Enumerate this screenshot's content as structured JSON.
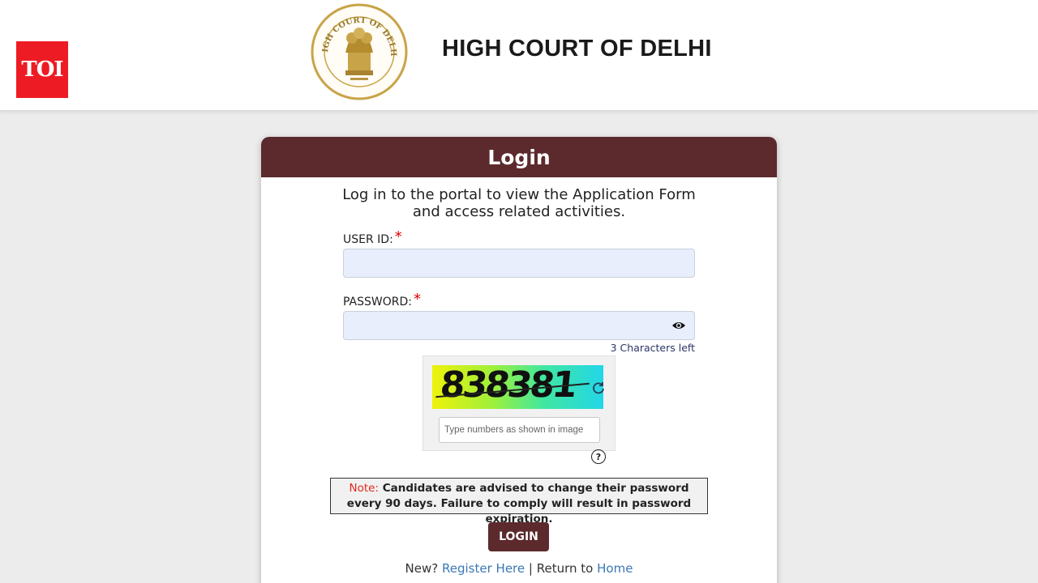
{
  "header": {
    "publisher_logo": "TOI",
    "title": "HIGH COURT OF DELHI",
    "emblem_text": "HIGH COURT OF DELHI"
  },
  "login": {
    "title": "Login",
    "intro_line1": "Log in to the portal to view the Application Form",
    "intro_line2": "and access related activities.",
    "user_id_label": "USER ID:",
    "password_label": "PASSWORD:",
    "required_mark": "*",
    "chars_left": "3 Characters left",
    "captcha_code": "838381",
    "captcha_placeholder": "Type numbers as shown in image",
    "help_glyph": "?",
    "note_label": "Note:",
    "note_text": "Candidates are advised to change their password every 90 days. Failure to comply will result in password expiration.",
    "login_button": "LOGIN",
    "new_text": "New?",
    "register_link": "Register Here",
    "separator": "|",
    "return_text": "Return to",
    "home_link": "Home"
  },
  "colors": {
    "header_bar": "#5c2a2d",
    "toi_red": "#ed1c24",
    "link": "#3a78b5",
    "required": "#e00000"
  },
  "icons": [
    "eye-icon",
    "refresh-icon",
    "help-icon",
    "state-emblem-icon"
  ]
}
